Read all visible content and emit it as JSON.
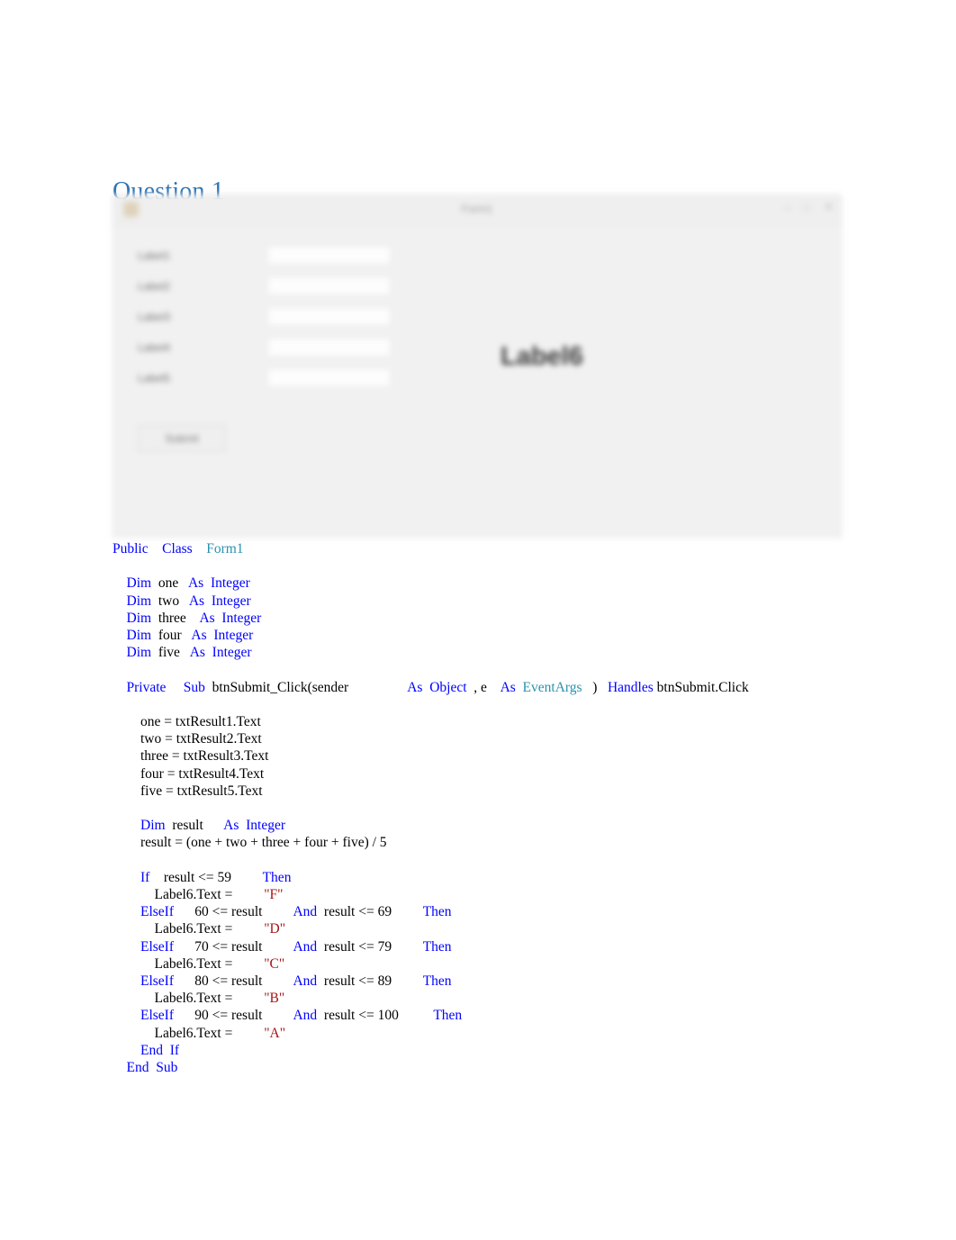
{
  "document": {
    "heading": "Question 1",
    "heading_color": "#2E74B5"
  },
  "form_screenshot": {
    "window_title": "Form1",
    "icon": "app-icon",
    "window_buttons": [
      "–",
      "□",
      "✕"
    ],
    "labels": [
      "Label1",
      "Label2",
      "Label3",
      "Label4",
      "Label5"
    ],
    "textboxes": [
      {
        "name": "txtResult1",
        "value": ""
      },
      {
        "name": "txtResult2",
        "value": ""
      },
      {
        "name": "txtResult3",
        "value": ""
      },
      {
        "name": "txtResult4",
        "value": ""
      },
      {
        "name": "txtResult5",
        "value": ""
      }
    ],
    "submit_button": "Submit",
    "result_label": "Label6"
  },
  "code": {
    "language": "Visual Basic .NET",
    "colors": {
      "keyword": "#0000FF",
      "type": "#2B91AF",
      "string": "#A31515",
      "plain": "#000000"
    },
    "lines": [
      {
        "id": "l01",
        "segments": [
          {
            "t": "Public",
            "c": "kw"
          },
          {
            "t": "    ",
            "c": "p"
          },
          {
            "t": "Class",
            "c": "kw"
          },
          {
            "t": "    ",
            "c": "p"
          },
          {
            "t": "Form1",
            "c": "typ"
          }
        ]
      },
      {
        "id": "l02",
        "segments": []
      },
      {
        "id": "l03",
        "segments": [
          {
            "t": "    ",
            "c": "p"
          },
          {
            "t": "Dim",
            "c": "kw"
          },
          {
            "t": "  one   ",
            "c": "p"
          },
          {
            "t": "As",
            "c": "kw"
          },
          {
            "t": "  ",
            "c": "p"
          },
          {
            "t": "Integer",
            "c": "kw"
          }
        ]
      },
      {
        "id": "l04",
        "segments": [
          {
            "t": "    ",
            "c": "p"
          },
          {
            "t": "Dim",
            "c": "kw"
          },
          {
            "t": "  two   ",
            "c": "p"
          },
          {
            "t": "As",
            "c": "kw"
          },
          {
            "t": "  ",
            "c": "p"
          },
          {
            "t": "Integer",
            "c": "kw"
          }
        ]
      },
      {
        "id": "l05",
        "segments": [
          {
            "t": "    ",
            "c": "p"
          },
          {
            "t": "Dim",
            "c": "kw"
          },
          {
            "t": "  three    ",
            "c": "p"
          },
          {
            "t": "As",
            "c": "kw"
          },
          {
            "t": "  ",
            "c": "p"
          },
          {
            "t": "Integer",
            "c": "kw"
          }
        ]
      },
      {
        "id": "l06",
        "segments": [
          {
            "t": "    ",
            "c": "p"
          },
          {
            "t": "Dim",
            "c": "kw"
          },
          {
            "t": "  four   ",
            "c": "p"
          },
          {
            "t": "As",
            "c": "kw"
          },
          {
            "t": "  ",
            "c": "p"
          },
          {
            "t": "Integer",
            "c": "kw"
          }
        ]
      },
      {
        "id": "l07",
        "segments": [
          {
            "t": "    ",
            "c": "p"
          },
          {
            "t": "Dim",
            "c": "kw"
          },
          {
            "t": "  five   ",
            "c": "p"
          },
          {
            "t": "As",
            "c": "kw"
          },
          {
            "t": "  ",
            "c": "p"
          },
          {
            "t": "Integer",
            "c": "kw"
          }
        ]
      },
      {
        "id": "l08",
        "segments": []
      },
      {
        "id": "l09",
        "segments": [
          {
            "t": "    ",
            "c": "p"
          },
          {
            "t": "Private",
            "c": "kw"
          },
          {
            "t": "     ",
            "c": "p"
          },
          {
            "t": "Sub",
            "c": "kw"
          },
          {
            "t": "  btnSubmit_Click(sender                 ",
            "c": "p"
          },
          {
            "t": "As",
            "c": "kw"
          },
          {
            "t": "  ",
            "c": "p"
          },
          {
            "t": "Object",
            "c": "kw"
          },
          {
            "t": "  , e    ",
            "c": "p"
          },
          {
            "t": "As",
            "c": "kw"
          },
          {
            "t": "  ",
            "c": "p"
          },
          {
            "t": "EventArgs",
            "c": "typ"
          },
          {
            "t": "   )   ",
            "c": "p"
          },
          {
            "t": "Handles",
            "c": "kw"
          },
          {
            "t": " btnSubmit.Click",
            "c": "p"
          }
        ]
      },
      {
        "id": "l10",
        "segments": []
      },
      {
        "id": "l11",
        "segments": [
          {
            "t": "        one = txtResult1.Text",
            "c": "p"
          }
        ]
      },
      {
        "id": "l12",
        "segments": [
          {
            "t": "        two = txtResult2.Text",
            "c": "p"
          }
        ]
      },
      {
        "id": "l13",
        "segments": [
          {
            "t": "        three = txtResult3.Text",
            "c": "p"
          }
        ]
      },
      {
        "id": "l14",
        "segments": [
          {
            "t": "        four = txtResult4.Text",
            "c": "p"
          }
        ]
      },
      {
        "id": "l15",
        "segments": [
          {
            "t": "        five = txtResult5.Text",
            "c": "p"
          }
        ]
      },
      {
        "id": "l16",
        "segments": []
      },
      {
        "id": "l17",
        "segments": [
          {
            "t": "        ",
            "c": "p"
          },
          {
            "t": "Dim",
            "c": "kw"
          },
          {
            "t": "  result      ",
            "c": "p"
          },
          {
            "t": "As",
            "c": "kw"
          },
          {
            "t": "  ",
            "c": "p"
          },
          {
            "t": "Integer",
            "c": "kw"
          }
        ]
      },
      {
        "id": "l18",
        "segments": [
          {
            "t": "        result = (one + two + three + four + five) / 5",
            "c": "p"
          }
        ]
      },
      {
        "id": "l19",
        "segments": []
      },
      {
        "id": "l20",
        "segments": [
          {
            "t": "        ",
            "c": "p"
          },
          {
            "t": "If",
            "c": "kw"
          },
          {
            "t": "    result <= 59         ",
            "c": "p"
          },
          {
            "t": "Then",
            "c": "kw"
          }
        ]
      },
      {
        "id": "l21",
        "segments": [
          {
            "t": "            Label6.Text =         ",
            "c": "p"
          },
          {
            "t": "\"F\"",
            "c": "str"
          }
        ]
      },
      {
        "id": "l22",
        "segments": [
          {
            "t": "        ",
            "c": "p"
          },
          {
            "t": "ElseIf",
            "c": "kw"
          },
          {
            "t": "      60 <= result         ",
            "c": "p"
          },
          {
            "t": "And",
            "c": "kw"
          },
          {
            "t": "  result <= 69         ",
            "c": "p"
          },
          {
            "t": "Then",
            "c": "kw"
          }
        ]
      },
      {
        "id": "l23",
        "segments": [
          {
            "t": "            Label6.Text =         ",
            "c": "p"
          },
          {
            "t": "\"D\"",
            "c": "str"
          }
        ]
      },
      {
        "id": "l24",
        "segments": [
          {
            "t": "        ",
            "c": "p"
          },
          {
            "t": "ElseIf",
            "c": "kw"
          },
          {
            "t": "      70 <= result         ",
            "c": "p"
          },
          {
            "t": "And",
            "c": "kw"
          },
          {
            "t": "  result <= 79         ",
            "c": "p"
          },
          {
            "t": "Then",
            "c": "kw"
          }
        ]
      },
      {
        "id": "l25",
        "segments": [
          {
            "t": "            Label6.Text =         ",
            "c": "p"
          },
          {
            "t": "\"C\"",
            "c": "str"
          }
        ]
      },
      {
        "id": "l26",
        "segments": [
          {
            "t": "        ",
            "c": "p"
          },
          {
            "t": "ElseIf",
            "c": "kw"
          },
          {
            "t": "      80 <= result         ",
            "c": "p"
          },
          {
            "t": "And",
            "c": "kw"
          },
          {
            "t": "  result <= 89         ",
            "c": "p"
          },
          {
            "t": "Then",
            "c": "kw"
          }
        ]
      },
      {
        "id": "l27",
        "segments": [
          {
            "t": "            Label6.Text =         ",
            "c": "p"
          },
          {
            "t": "\"B\"",
            "c": "str"
          }
        ]
      },
      {
        "id": "l28",
        "segments": [
          {
            "t": "        ",
            "c": "p"
          },
          {
            "t": "ElseIf",
            "c": "kw"
          },
          {
            "t": "      90 <= result         ",
            "c": "p"
          },
          {
            "t": "And",
            "c": "kw"
          },
          {
            "t": "  result <= 100          ",
            "c": "p"
          },
          {
            "t": "Then",
            "c": "kw"
          }
        ]
      },
      {
        "id": "l29",
        "segments": [
          {
            "t": "            Label6.Text =         ",
            "c": "p"
          },
          {
            "t": "\"A\"",
            "c": "str"
          }
        ]
      },
      {
        "id": "l30",
        "segments": [
          {
            "t": "        ",
            "c": "p"
          },
          {
            "t": "End",
            "c": "kw"
          },
          {
            "t": "  ",
            "c": "p"
          },
          {
            "t": "If",
            "c": "kw"
          }
        ]
      },
      {
        "id": "l31",
        "segments": [
          {
            "t": "    ",
            "c": "p"
          },
          {
            "t": "End",
            "c": "kw"
          },
          {
            "t": "  ",
            "c": "p"
          },
          {
            "t": "Sub",
            "c": "kw"
          }
        ]
      }
    ]
  }
}
